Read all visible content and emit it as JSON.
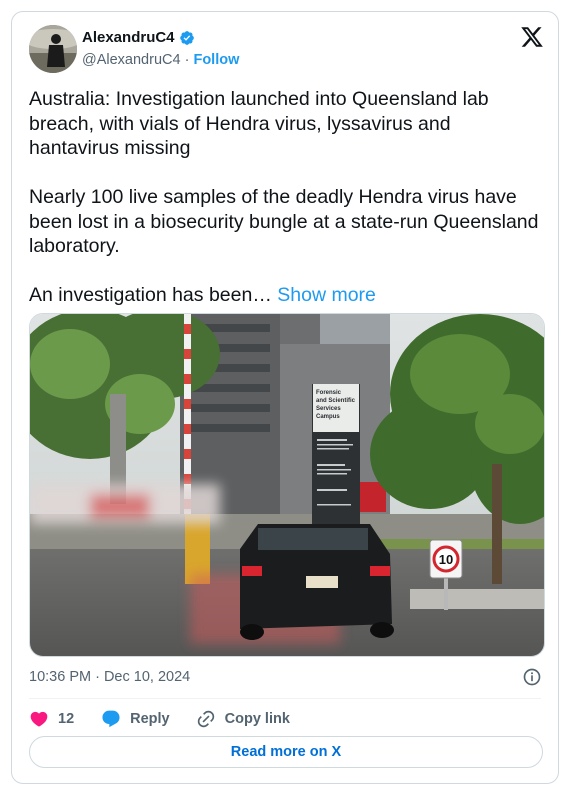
{
  "author": {
    "display_name": "AlexandruC4",
    "handle": "@AlexandruC4",
    "separator": "·",
    "follow_label": "Follow",
    "verified_color": "#1d9bf0"
  },
  "tweet": {
    "paragraph_1": "Australia: Investigation launched into Queensland lab breach, with vials of Hendra virus, lyssavirus and hantavirus missing",
    "paragraph_2": "Nearly 100 live samples of the deadly Hendra virus have been lost in a biosecurity bungle at a state-run Queensland laboratory.",
    "paragraph_3": "An investigation has been…",
    "show_more_label": "Show more"
  },
  "media": {
    "sign_lines": [
      "Forensic",
      "and Scientific",
      "Services",
      "Campus"
    ],
    "speed_sign": "10"
  },
  "meta": {
    "timestamp": "10:36 PM · Dec 10, 2024"
  },
  "actions": {
    "like_count": "12",
    "reply_label": "Reply",
    "copy_link_label": "Copy link"
  },
  "read_more_label": "Read more on X",
  "colors": {
    "accent": "#1d9bf0",
    "like": "#f91880",
    "text_secondary": "#536471",
    "border": "#cfd9de"
  },
  "icons": [
    "verified-badge-icon",
    "x-logo-icon",
    "info-icon",
    "heart-icon",
    "reply-bubble-icon",
    "link-icon"
  ]
}
